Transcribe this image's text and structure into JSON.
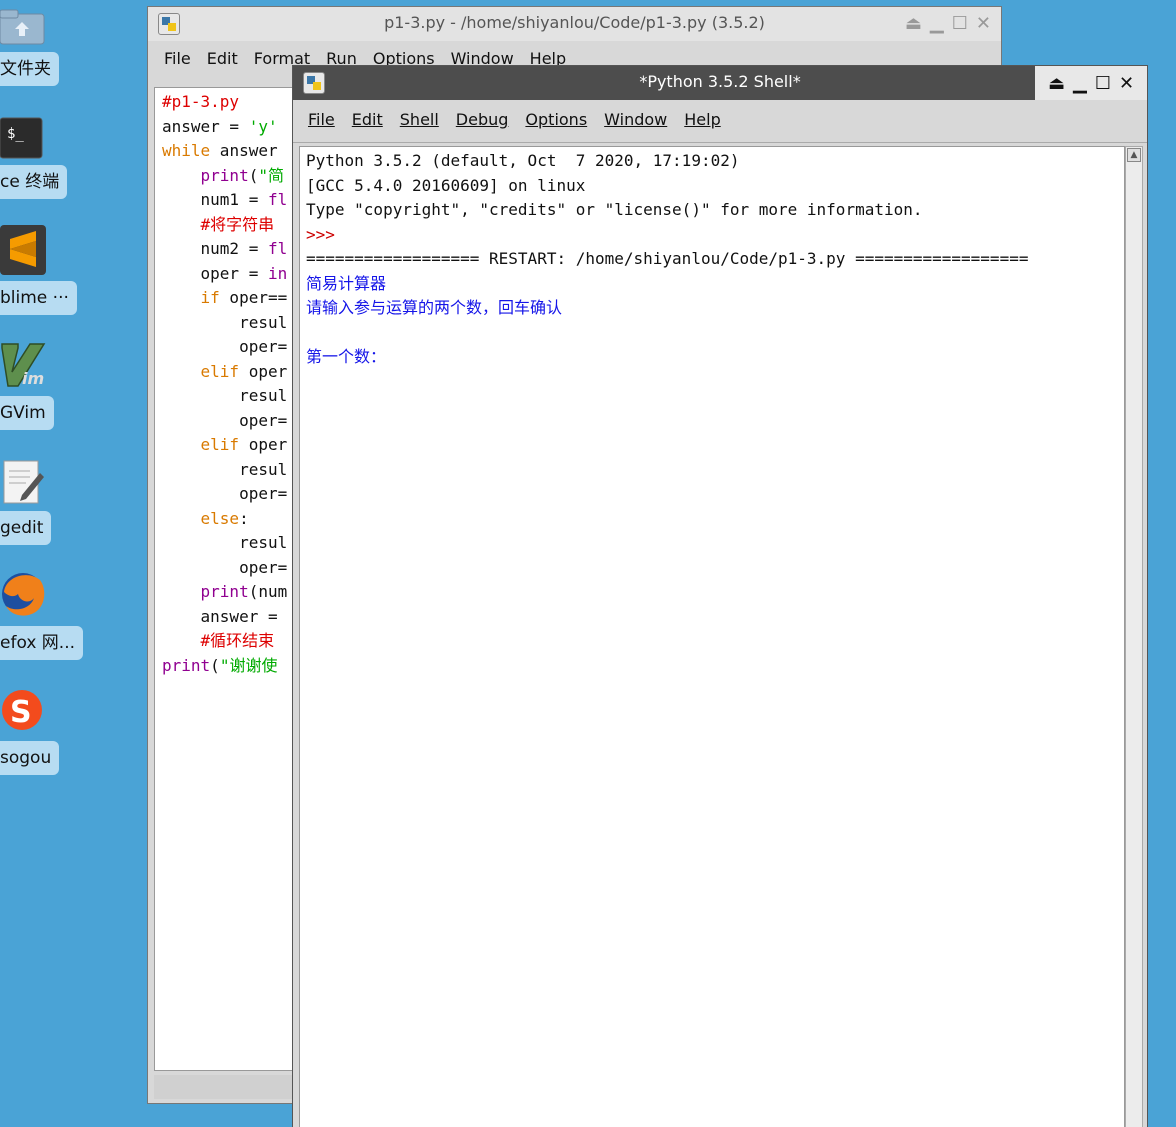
{
  "desktop_icons": [
    {
      "name": "folder",
      "label": "文件夹"
    },
    {
      "name": "terminal",
      "label": "ce 终端"
    },
    {
      "name": "sublime",
      "label": "blime ···"
    },
    {
      "name": "gvim",
      "label": "GVim"
    },
    {
      "name": "gedit",
      "label": "gedit"
    },
    {
      "name": "firefox",
      "label": "efox 网..."
    },
    {
      "name": "sogou",
      "label": "sogou"
    }
  ],
  "editor": {
    "title": "p1-3.py - /home/shiyanlou/Code/p1-3.py (3.5.2)",
    "menu": [
      "File",
      "Edit",
      "Format",
      "Run",
      "Options",
      "Window",
      "Help"
    ],
    "lines": [
      "#p1-3.py",
      "answer = 'y'",
      "while answer",
      "    print(\"简",
      "    num1 = fl",
      "    #将字符串",
      "    num2 = fl",
      "    oper = in",
      "    if oper==",
      "        resul",
      "        oper=",
      "    elif oper",
      "        resul",
      "        oper=",
      "    elif oper",
      "        resul",
      "        oper=",
      "    else:",
      "        resul",
      "        oper=",
      "    print(num",
      "    answer = ",
      "    #循环结束",
      "print(\"谢谢使"
    ]
  },
  "shell": {
    "title": "*Python 3.5.2 Shell*",
    "menu": [
      "File",
      "Edit",
      "Shell",
      "Debug",
      "Options",
      "Window",
      "Help"
    ],
    "banner1": "Python 3.5.2 (default, Oct  7 2020, 17:19:02)",
    "banner2": "[GCC 5.4.0 20160609] on linux",
    "banner3": "Type \"copyright\", \"credits\" or \"license()\" for more information.",
    "prompt": ">>> ",
    "restart": "================== RESTART: /home/shiyanlou/Code/p1-3.py ==================",
    "out1": "简易计算器",
    "out2": "请输入参与运算的两个数，回车确认",
    "out3": "第一个数："
  },
  "colors": {
    "desktop": "#4aa3d6",
    "shell_titlebar": "#4d4d4d",
    "output_text": "#1515e8",
    "prompt": "#cc0000"
  }
}
